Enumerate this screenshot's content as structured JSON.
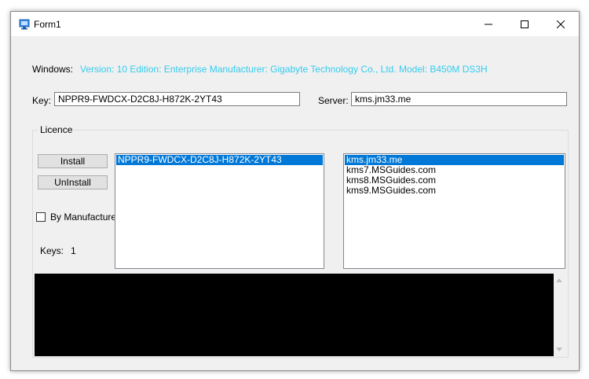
{
  "window": {
    "title": "Form1"
  },
  "titlebar_buttons": {
    "minimize": "minimize-icon",
    "maximize": "maximize-icon",
    "close": "close-icon"
  },
  "windows_info": {
    "label": "Windows:",
    "value": "Version: 10 Edition: Enterprise Manufacturer: Gigabyte Technology Co., Ltd. Model: B450M DS3H"
  },
  "key": {
    "label": "Key:",
    "value": "NPPR9-FWDCX-D2C8J-H872K-2YT43"
  },
  "server": {
    "label": "Server:",
    "value": "kms.jm33.me"
  },
  "licence": {
    "group_title": "Licence",
    "install_label": "Install",
    "uninstall_label": "UnInstall",
    "by_manufacture_label": "By Manufacture",
    "keys_label": "Keys:",
    "keys_count": "1",
    "key_list": [
      "NPPR9-FWDCX-D2C8J-H872K-2YT43"
    ],
    "server_list": [
      "kms.jm33.me",
      "kms7.MSGuides.com",
      "kms8.MSGuides.com",
      "kms9.MSGuides.com"
    ]
  },
  "colors": {
    "accent": "#0078d7",
    "info_text": "#33ccee",
    "console_bg": "#000000"
  }
}
